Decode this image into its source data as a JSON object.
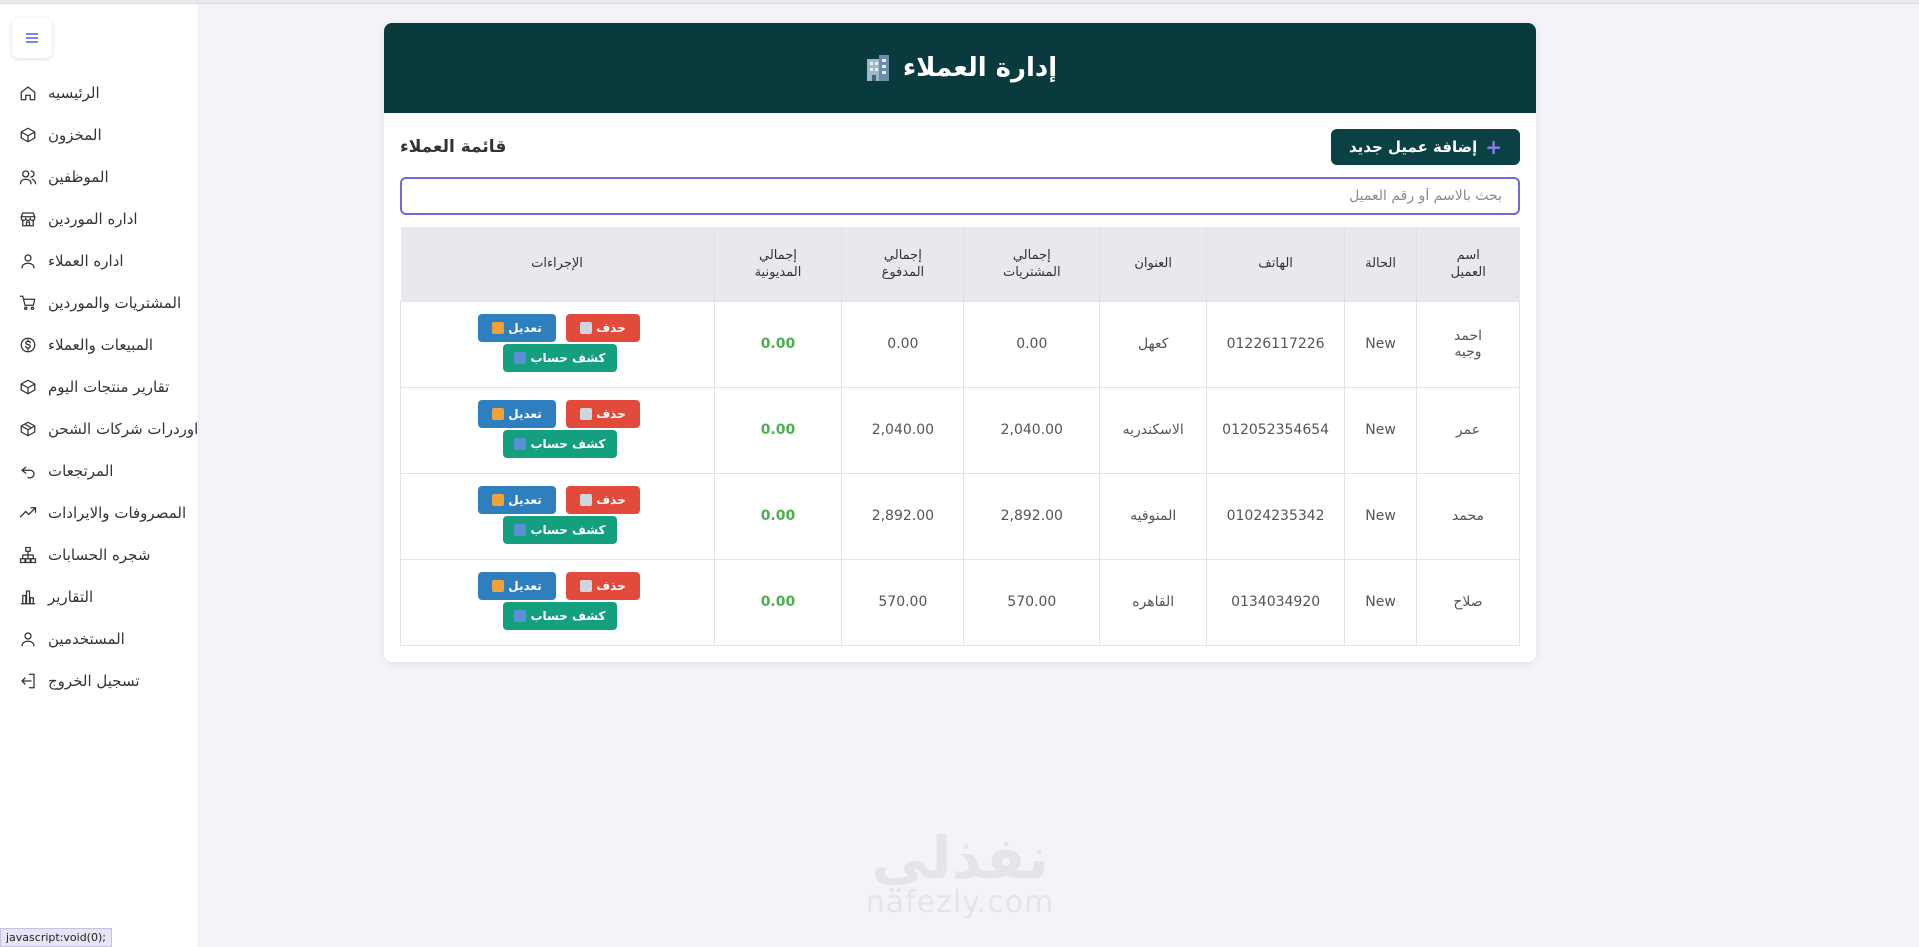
{
  "sidebar": {
    "toggle_icon": "hamburger-icon",
    "items": [
      {
        "label": "الرئيسيه",
        "icon": "home-icon"
      },
      {
        "label": "المخزون",
        "icon": "box-icon"
      },
      {
        "label": "الموظفين",
        "icon": "users-icon"
      },
      {
        "label": "اداره الموردين",
        "icon": "store-icon"
      },
      {
        "label": "اداره العملاء",
        "icon": "user-icon"
      },
      {
        "label": "المشتريات والموردين",
        "icon": "cart-icon"
      },
      {
        "label": "المبيعات والعملاء",
        "icon": "dollar-icon"
      },
      {
        "label": "تقارير منتجات اليوم",
        "icon": "package-icon"
      },
      {
        "label": "اوردرات شركات الشحن",
        "icon": "package-icon"
      },
      {
        "label": "المرتجعات",
        "icon": "undo-icon"
      },
      {
        "label": "المصروفات والايرادات",
        "icon": "trend-icon"
      },
      {
        "label": "شجره الحسابات",
        "icon": "tree-icon"
      },
      {
        "label": "التقارير",
        "icon": "bar-chart-icon"
      },
      {
        "label": "المستخدمين",
        "icon": "user-icon"
      },
      {
        "label": "تسجيل الخروج",
        "icon": "logout-icon"
      }
    ]
  },
  "status_bar": {
    "url": "javascript:void(0);"
  },
  "header": {
    "title": "إدارة العملاء",
    "icon": "building-icon"
  },
  "toolbar": {
    "add_label": "إضافة عميل جديد",
    "list_title": "قائمة العملاء"
  },
  "search": {
    "placeholder": "بحث بالاسم أو رقم العميل"
  },
  "table": {
    "columns": [
      "الإجراءات",
      "إجمالي المديونية",
      "إجمالي المدفوع",
      "إجمالي المشتريات",
      "العنوان",
      "الهاتف",
      "الحالة",
      "اسم العميل"
    ],
    "actions": {
      "delete": "حذف",
      "edit": "تعديل",
      "statement": "كشف حساب"
    },
    "rows": [
      {
        "debt": "0.00",
        "paid": "0.00",
        "purchases": "0.00",
        "address": "كعهل",
        "phone": "01226117226",
        "status": "New",
        "name": "احمد وجيه"
      },
      {
        "debt": "0.00",
        "paid": "2,040.00",
        "purchases": "2,040.00",
        "address": "الاسكندريه",
        "phone": "012052354654",
        "status": "New",
        "name": "عمر"
      },
      {
        "debt": "0.00",
        "paid": "2,892.00",
        "purchases": "2,892.00",
        "address": "المنوفيه",
        "phone": "01024235342",
        "status": "New",
        "name": "محمد"
      },
      {
        "debt": "0.00",
        "paid": "570.00",
        "purchases": "570.00",
        "address": "القاهره",
        "phone": "0134034920",
        "status": "New",
        "name": "صلاح"
      }
    ]
  },
  "watermark": {
    "arabic": "نفذلي",
    "latin": "nafezly.com"
  },
  "colors": {
    "header_bg": "#083a3e",
    "debt": "#4caf50",
    "delete": "#e24a3b",
    "edit": "#2e7fc0",
    "statement": "#14a07f",
    "search_border": "#6f6ad8"
  }
}
